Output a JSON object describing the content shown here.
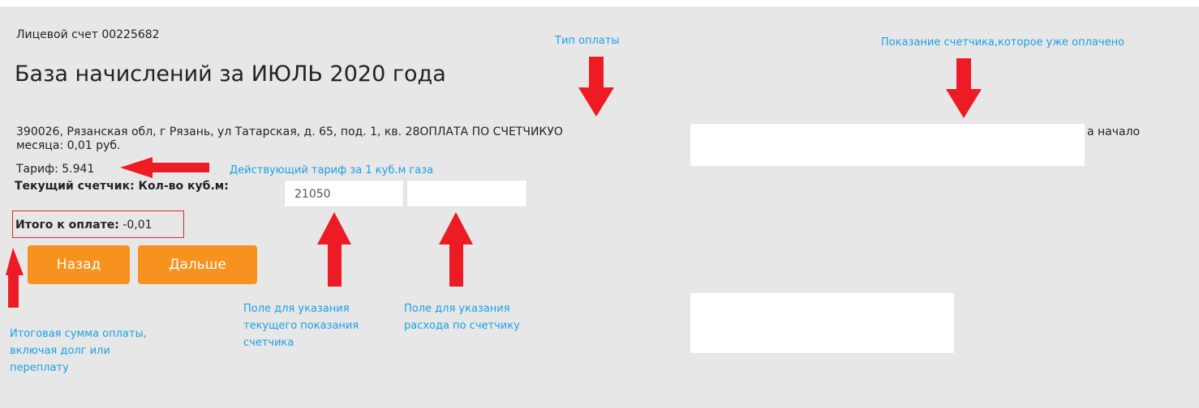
{
  "account": {
    "label": "Лицевой счет 00225682"
  },
  "page_title": "База начислений за ИЮЛЬ 2020 года",
  "address_line": "390026, Рязанская обл, г Рязань, ул Татарская, д. 65, под. 1, кв. 28ОПЛАТА ПО СЧЕТЧИКУО",
  "address_line_tail": "а начало",
  "address_line2": "месяца: 0,01 руб.",
  "tariff_text": "Тариф: 5.941",
  "meter": {
    "label": "Текущий счетчик: Кол-во куб.м:",
    "current_value": "21050",
    "consumption_value": ""
  },
  "total": {
    "label": "Итого к оплате:",
    "value": " -0,01"
  },
  "buttons": {
    "back": "Назад",
    "next": "Дальше"
  },
  "annotations": {
    "payment_type": "Тип оплаты",
    "paid_reading": "Показание счетчика,которое уже оплачено",
    "tariff_note": "Действующий тариф за 1 куб.м газа",
    "current_field": [
      "Поле для указания",
      "текущего показания",
      "счетчика"
    ],
    "consumption_field": [
      "Поле для указания",
      "расхода по счетчику"
    ],
    "total_note": [
      "Итоговая сумма оплаты,",
      "включая долг или",
      "переплату"
    ]
  },
  "colors": {
    "annotation": "#1aa0e5",
    "arrow": "#ed1c24",
    "button": "#f7921e",
    "panel": "#e7e7e7"
  }
}
